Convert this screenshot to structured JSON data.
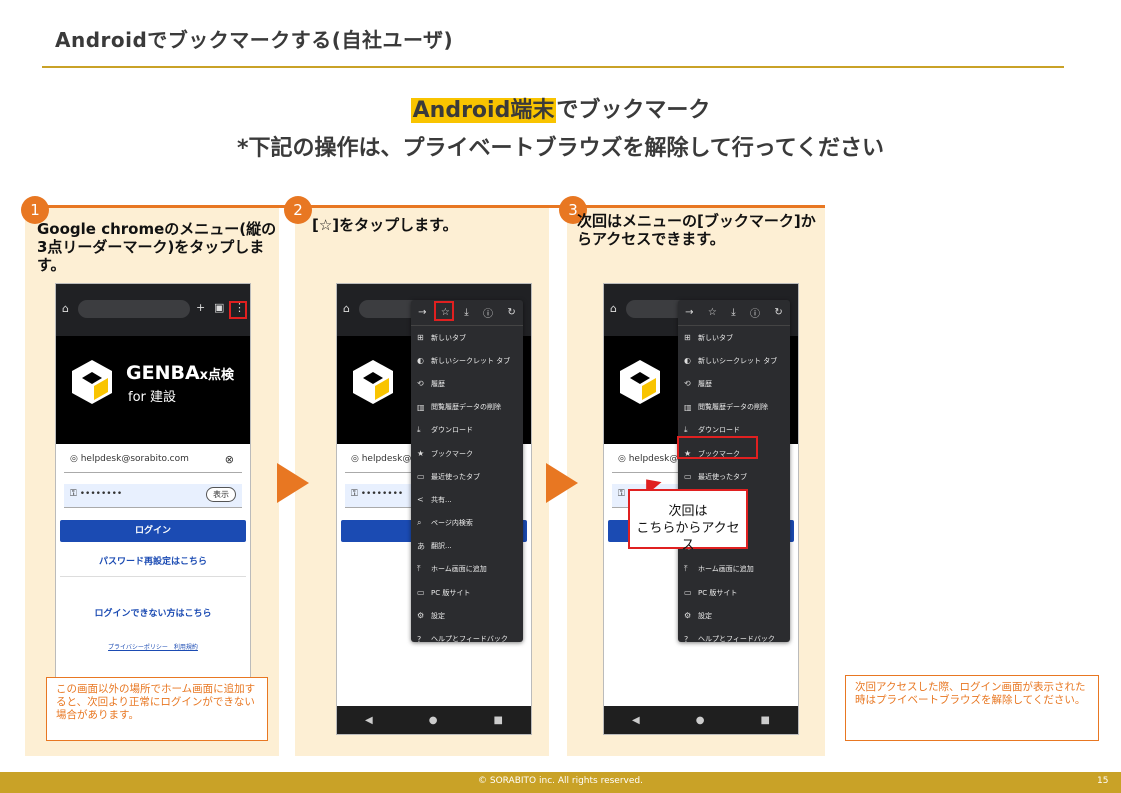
{
  "page": {
    "title": "Androidでブックマークする(自社ユーザ)",
    "headline_highlight": "Android端末",
    "headline_rest": "でブックマーク",
    "subheadline": "*下記の操作は、プライベートブラウズを解除して行ってください"
  },
  "steps": [
    {
      "number": "1",
      "text": "Google chromeのメニュー(縦の3点リーダーマーク)をタップします。"
    },
    {
      "number": "2",
      "text": "[☆]をタップします。"
    },
    {
      "number": "3",
      "text": "次回はメニューの[ブックマーク]からアクセスできます。"
    }
  ],
  "phone": {
    "logo_main": "GENBA",
    "logo_x": "x点検",
    "logo_sub": "for 建設",
    "email_value": "helpdesk@sorabito.com",
    "password_mask": "••••••••",
    "show_button": "表示",
    "login_button": "ログイン",
    "password_reset": "パスワード再設定はこちら",
    "cant_login": "ログインできない方はこちら",
    "policy_links": "プライバシーポリシー　利用規約",
    "nav_back": "◀",
    "nav_home": "●",
    "nav_recent": "■"
  },
  "menu": {
    "items": [
      {
        "icon": "⊞",
        "label": "新しいタブ"
      },
      {
        "icon": "◐",
        "label": "新しいシークレット タブ"
      },
      {
        "icon": "⟲",
        "label": "履歴"
      },
      {
        "icon": "▥",
        "label": "閲覧履歴データの削除"
      },
      {
        "icon": "⤓",
        "label": "ダウンロード"
      },
      {
        "icon": "★",
        "label": "ブックマーク"
      },
      {
        "icon": "▭",
        "label": "最近使ったタブ"
      },
      {
        "icon": "<",
        "label": "共有..."
      },
      {
        "icon": "⌕",
        "label": "ページ内検索"
      },
      {
        "icon": "あ",
        "label": "翻訳..."
      },
      {
        "icon": "⤒",
        "label": "ホーム画面に追加"
      },
      {
        "icon": "▭",
        "label": "PC 版サイト"
      },
      {
        "icon": "⚙",
        "label": "設定"
      },
      {
        "icon": "?",
        "label": "ヘルプとフィードバック"
      }
    ]
  },
  "callout": {
    "line1": "次回は",
    "line2": "こちらからアクセス"
  },
  "notes": {
    "left": "この画面以外の場所でホーム画面に追加すると、次回より正常にログインができない場合があります。",
    "right": "次回アクセスした際、ログイン画面が表示された時はプライベートブラウズを解除してください。"
  },
  "footer": {
    "copyright": "© SORABITO inc. All rights reserved.",
    "page_number": "15"
  },
  "colors": {
    "accent": "#e87722",
    "gold": "#c9a227",
    "highlight": "#f9c400",
    "panel": "#fdefd4",
    "red": "#e02020"
  }
}
